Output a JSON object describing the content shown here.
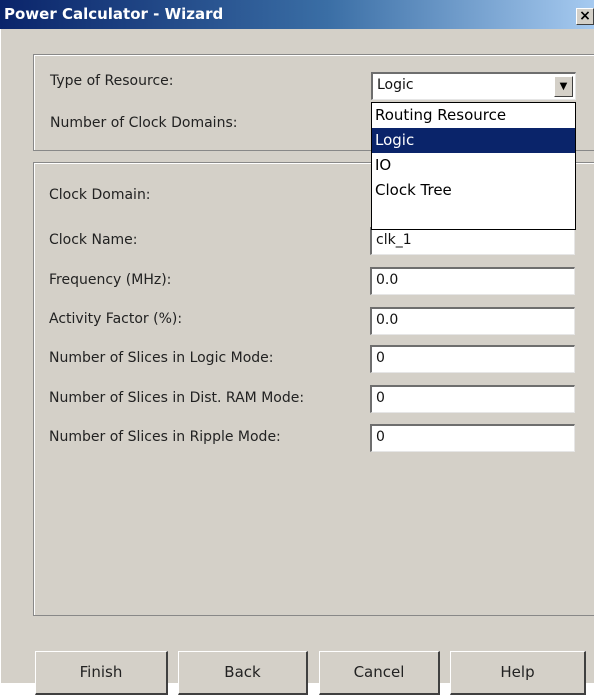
{
  "window": {
    "title": "Power Calculator - Wizard",
    "close_glyph": "×"
  },
  "resource": {
    "type_label": "Type of Resource:",
    "type_value": "Logic",
    "clock_domains_label": "Number of Clock Domains:",
    "dropdown_options": [
      "Routing Resource",
      "Logic",
      "IO",
      "Clock Tree"
    ],
    "selected_option": "Logic"
  },
  "clock": {
    "domain_label": "Clock Domain:",
    "name_label": "Clock Name:",
    "name_value": "clk_1",
    "frequency_label": "Frequency (MHz):",
    "frequency_value": "0.0",
    "activity_label": "Activity Factor (%):",
    "activity_value": "0.0",
    "slices_logic_label": "Number of Slices in Logic Mode:",
    "slices_logic_value": "0",
    "slices_ram_label": "Number of Slices in Dist. RAM Mode:",
    "slices_ram_value": "0",
    "slices_ripple_label": "Number of Slices in Ripple Mode:",
    "slices_ripple_value": "0"
  },
  "buttons": {
    "finish": "Finish",
    "back": "Back",
    "cancel": "Cancel",
    "help": "Help"
  },
  "icons": {
    "dropdown_arrow": "▼"
  }
}
